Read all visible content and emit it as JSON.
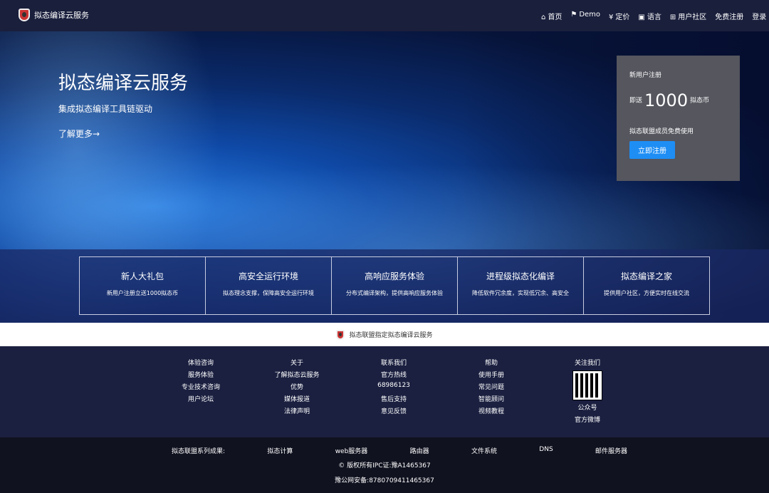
{
  "header": {
    "brand": "拟态编译云服务",
    "menu": [
      {
        "icon": "home-icon",
        "glyph": "⌂",
        "label": "首页"
      },
      {
        "icon": "flag-icon",
        "glyph": "⚑",
        "label": "Demo"
      },
      {
        "icon": "yen-icon",
        "glyph": "¥",
        "label": "定价"
      },
      {
        "icon": "language-icon",
        "glyph": "▣",
        "label": "语言"
      },
      {
        "icon": "community-icon",
        "glyph": "⊞",
        "label": "用户社区"
      },
      {
        "icon": "",
        "glyph": "",
        "label": "免费注册"
      },
      {
        "icon": "",
        "glyph": "",
        "label": "登录"
      }
    ]
  },
  "hero": {
    "title": "拟态编译云服务",
    "subtitle": "集成拟态编译工具链驱动",
    "more": "了解更多→",
    "card": {
      "line1": "新用户注册",
      "prefix": "即送",
      "amount": "1000",
      "suffix": "拟态币",
      "line3": "拟态联盟成员免费使用",
      "button": "立即注册"
    }
  },
  "features": [
    {
      "title": "新人大礼包",
      "desc": "新用户注册立送1000拟态币"
    },
    {
      "title": "高安全运行环境",
      "desc": "拟态理念支撑，保障高安全运行环境"
    },
    {
      "title": "高响应服务体验",
      "desc": "分布式编译架构，提供高响应服务体验"
    },
    {
      "title": "进程级拟态化编译",
      "desc": "降低软件冗余度，实现低冗余、高安全"
    },
    {
      "title": "拟态编译之家",
      "desc": "提供用户社区，方便实时在线交流"
    }
  ],
  "band": {
    "text": "拟态联盟指定拟态编译云服务"
  },
  "footer": {
    "cols": [
      [
        "体验咨询",
        "服务体验",
        "专业技术咨询",
        "用户论坛"
      ],
      [
        "关于",
        "了解拟态云服务",
        "优势",
        "媒体报道",
        "法律声明"
      ],
      [
        "联系我们",
        "官方热线",
        "68986123",
        "售后支持",
        "意见反馈"
      ],
      [
        "帮助",
        "使用手册",
        "常见问题",
        "智能顾问",
        "视频教程"
      ]
    ],
    "follow": {
      "title": "关注我们",
      "qr_label": "公众号",
      "weibo": "官方微博"
    }
  },
  "bottom": {
    "series": [
      "拟态联盟系列成果:",
      "拟态计算",
      "web服务器",
      "路由器",
      "文件系统",
      "DNS",
      "邮件服务器"
    ],
    "copyright": "© 版权所有IPC证:豫A1465367",
    "icp": "豫公网安备:8780709411465367"
  }
}
